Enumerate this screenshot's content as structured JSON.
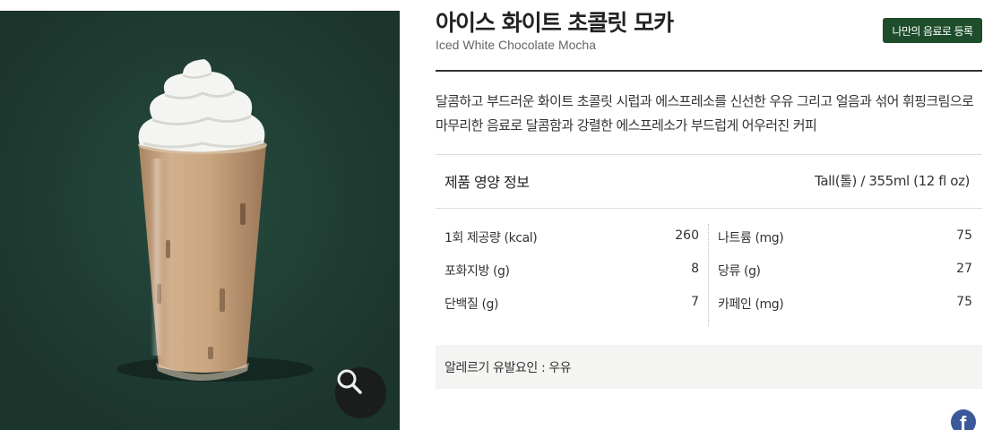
{
  "product": {
    "name_ko": "아이스 화이트 초콜릿 모카",
    "name_en": "Iced White Chocolate Mocha",
    "favorite_label": "나만의 음료로 등록",
    "description": "달콤하고 부드러운 화이트 초콜릿 시럽과 에스프레소를 신선한 우유 그리고 얼음과 섞어 휘핑크림으로 마무리한 음료로 달콤함과 강렬한 에스프레소가 부드럽게 어우러진 커피"
  },
  "nutrition": {
    "title": "제품 영양 정보",
    "size": "Tall(톨) / 355ml (12 fl oz)",
    "left": [
      {
        "label": "1회 제공량 (kcal)",
        "value": "260"
      },
      {
        "label": "포화지방 (g)",
        "value": "8"
      },
      {
        "label": "단백질 (g)",
        "value": "7"
      }
    ],
    "right": [
      {
        "label": "나트륨 (mg)",
        "value": "75"
      },
      {
        "label": "당류 (g)",
        "value": "27"
      },
      {
        "label": "카페인 (mg)",
        "value": "75"
      }
    ]
  },
  "allergy": "알레르기 유발요인 : 우유",
  "icons": {
    "zoom": "magnifier-icon",
    "share": "facebook-icon"
  },
  "colors": {
    "hero_bg": "#1f3a31",
    "brand_green": "#1e4d2b",
    "facebook": "#3b5998"
  }
}
